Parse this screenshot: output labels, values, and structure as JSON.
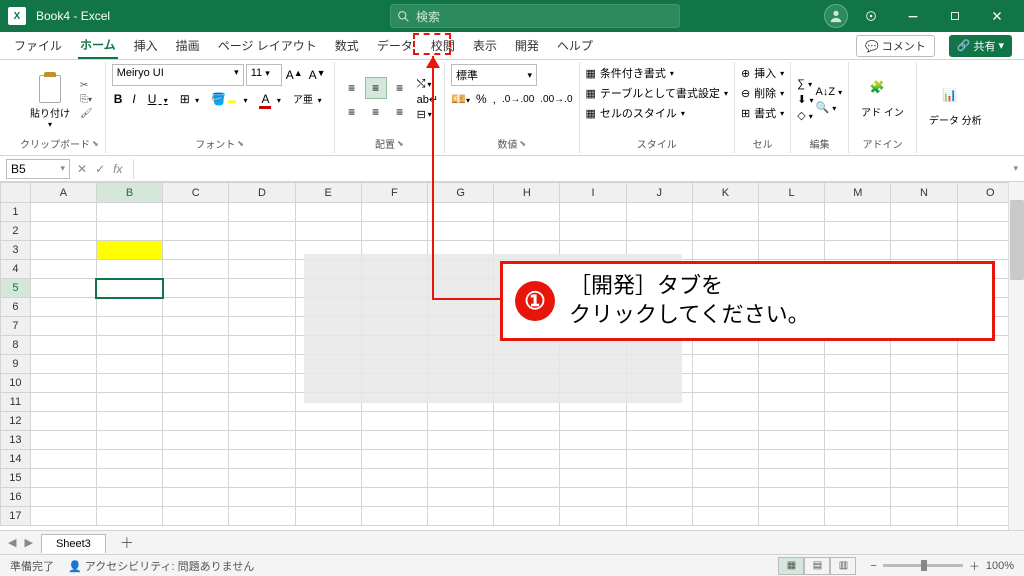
{
  "title": "Book4 - Excel",
  "search_placeholder": "検索",
  "tabs": [
    "ファイル",
    "ホーム",
    "挿入",
    "描画",
    "ページ レイアウト",
    "数式",
    "データ",
    "校閲",
    "表示",
    "開発",
    "ヘルプ"
  ],
  "active_tab": "ホーム",
  "comment_btn": "コメント",
  "share_btn": "共有",
  "ribbon": {
    "clipboard": {
      "paste": "貼り付け",
      "label": "クリップボード"
    },
    "font": {
      "name": "Meiryo UI",
      "size": "11",
      "label": "フォント",
      "bold": "B",
      "italic": "I",
      "underline": "U"
    },
    "align": {
      "label": "配置"
    },
    "number": {
      "format": "標準",
      "label": "数値"
    },
    "styles": {
      "cond": "条件付き書式",
      "table": "テーブルとして書式設定",
      "cell": "セルのスタイル",
      "label": "スタイル"
    },
    "cells": {
      "insert": "挿入",
      "delete": "削除",
      "format": "書式",
      "label": "セル"
    },
    "editing": {
      "label": "編集"
    },
    "addins": {
      "label": "アドイン",
      "btn": "アド\nイン"
    },
    "analysis": {
      "label": "",
      "btn": "データ\n分析"
    }
  },
  "namebox": "B5",
  "columns": [
    "A",
    "B",
    "C",
    "D",
    "E",
    "F",
    "G",
    "H",
    "I",
    "J",
    "K",
    "L",
    "M",
    "N",
    "O"
  ],
  "rows": [
    1,
    2,
    3,
    4,
    5,
    6,
    7,
    8,
    9,
    10,
    11,
    12,
    13,
    14,
    15,
    16,
    17
  ],
  "active_cell": "B5",
  "yellow_cell": "B3",
  "sheet_tab": "Sheet3",
  "status": {
    "ready": "準備完了",
    "acc": "アクセシビリティ: 問題ありません",
    "zoom": "100%"
  },
  "callout": {
    "num": "①",
    "text": "［開発］タブを\nクリックしてください。"
  }
}
